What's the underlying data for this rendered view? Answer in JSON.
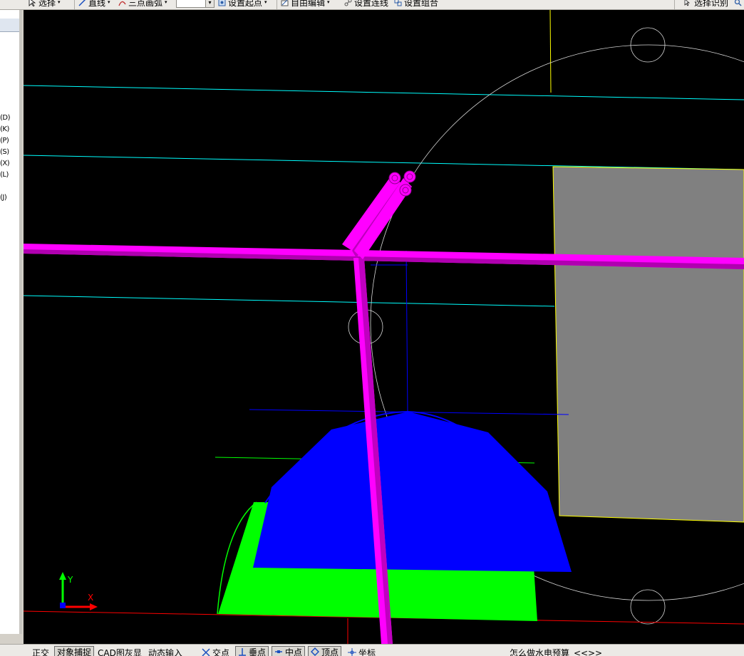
{
  "toolbar": {
    "select_label": "选择",
    "line_label": "直线",
    "arc_label": "三点画弧",
    "arc_value": "",
    "set_start_label": "设置起点",
    "auto_edit_label": "自由编辑",
    "set_connect_label": "设置连线",
    "set_combine_label": "设置组合",
    "select_identify_label": "选择识别"
  },
  "sidebar": {
    "shortcuts": [
      "(D)",
      "(K)",
      "(P)",
      "(S)",
      "(X)",
      "(L)",
      "(J)"
    ]
  },
  "statusbar": {
    "ortho_label": "正交",
    "osnap_label": "对象捕捉",
    "cad_gray_label": "CAD图灰显",
    "dynamic_input_label": "动态输入",
    "intersection_label": "交点",
    "perpendicular_label": "垂点",
    "midpoint_label": "中点",
    "vertex_label": "顶点",
    "coordinate_label": "坐标",
    "hint_label": "怎么做水电预算",
    "prev_label": "<<",
    "next_label": ">>"
  },
  "viewport": {
    "ucs_y_label": "Y",
    "ucs_x_label": "X"
  },
  "colors": {
    "canvas_bg": "#000000",
    "pipe": "#ff00ff",
    "blue_fill": "#0000ff",
    "green_fill": "#00ff00",
    "gray_panel": "#808080",
    "cyan_line": "#00ffff",
    "yellow_line": "#ffff00",
    "red_line": "#ff0000"
  }
}
